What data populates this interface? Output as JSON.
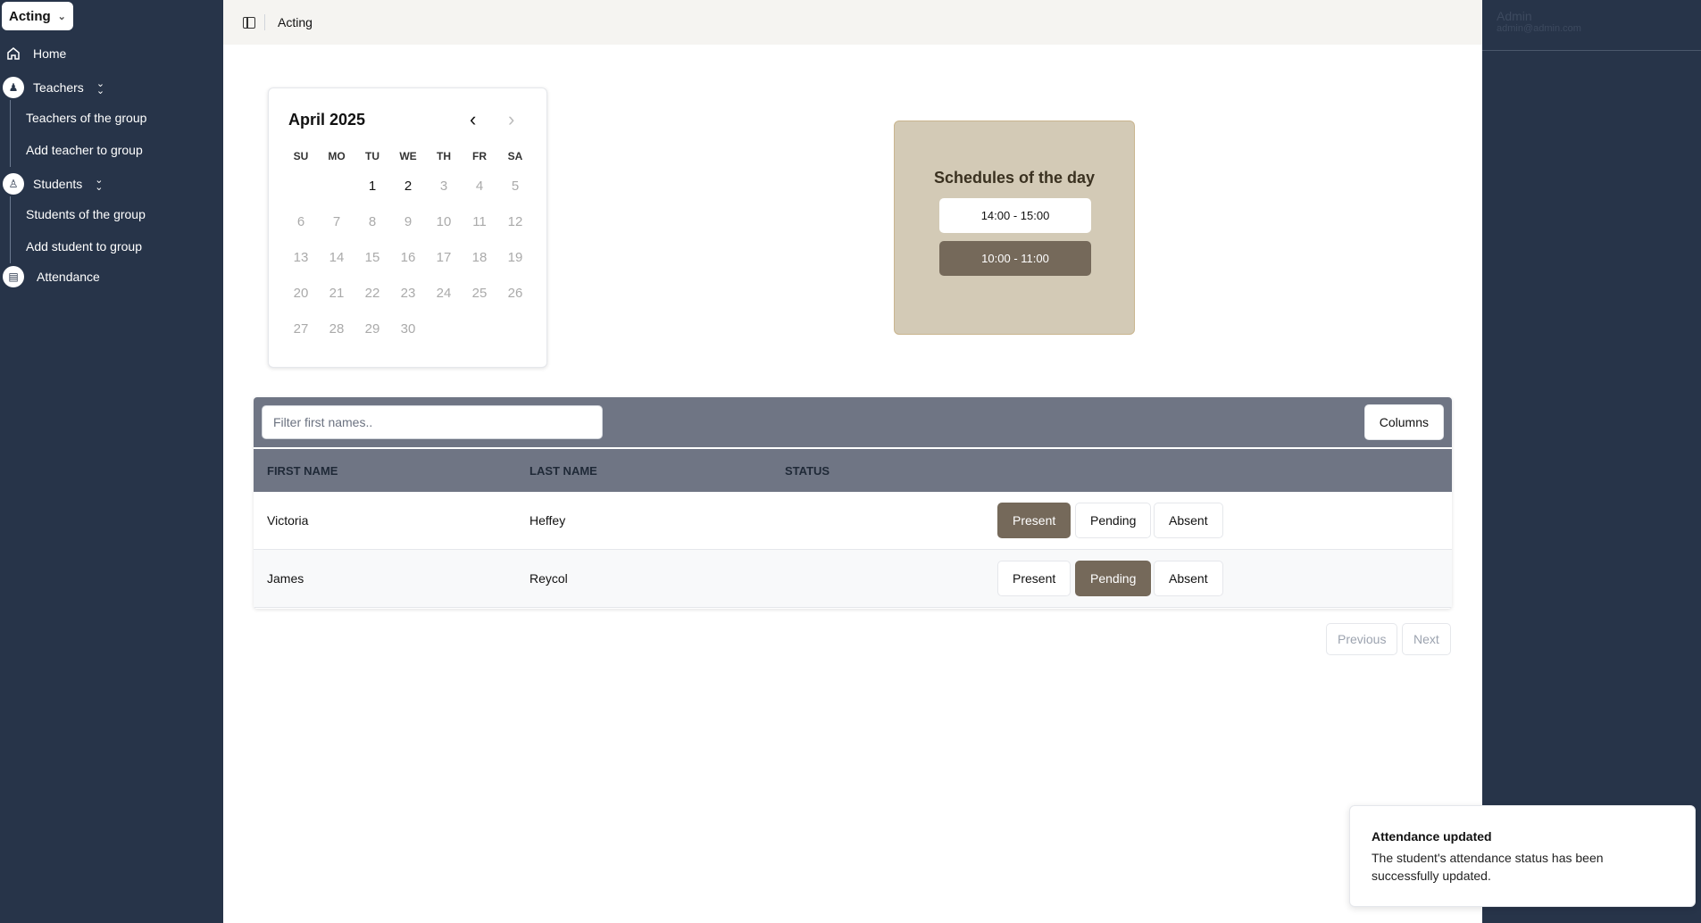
{
  "sidebar": {
    "group_select": "Acting",
    "home": "Home",
    "teachers": "Teachers",
    "teachers_sub": [
      "Teachers of the group",
      "Add teacher to group"
    ],
    "students": "Students",
    "students_sub": [
      "Students of the group",
      "Add student to group"
    ],
    "attendance": "Attendance"
  },
  "topbar": {
    "title": "Acting"
  },
  "user": {
    "name": "Admin",
    "email": "admin@admin.com"
  },
  "calendar": {
    "month": "April 2025",
    "weekdays": [
      "SU",
      "MO",
      "TU",
      "WE",
      "TH",
      "FR",
      "SA"
    ],
    "days": [
      "",
      "",
      "1",
      "2",
      "3",
      "4",
      "5",
      "6",
      "7",
      "8",
      "9",
      "10",
      "11",
      "12",
      "13",
      "14",
      "15",
      "16",
      "17",
      "18",
      "19",
      "20",
      "21",
      "22",
      "23",
      "24",
      "25",
      "26",
      "27",
      "28",
      "29",
      "30"
    ],
    "enabled_days": [
      "1",
      "2"
    ]
  },
  "schedules": {
    "title": "Schedules of the day",
    "slots": [
      "14:00 - 15:00",
      "10:00 - 11:00"
    ]
  },
  "table": {
    "filter_placeholder": "Filter first names..",
    "columns_label": "Columns",
    "headers": [
      "FIRST NAME",
      "LAST NAME",
      "STATUS"
    ],
    "status_options": [
      "Present",
      "Pending",
      "Absent"
    ],
    "rows": [
      {
        "first": "Victoria",
        "last": "Heffey",
        "status": "Present"
      },
      {
        "first": "James",
        "last": "Reycol",
        "status": "Pending"
      }
    ]
  },
  "pager": {
    "previous": "Previous",
    "next": "Next"
  },
  "toast": {
    "title": "Attendance updated",
    "body": "The student's attendance status has been successfully updated."
  },
  "colors": {
    "sidebar_bg": "#273449",
    "accent": "#75695a",
    "schedule_card": "#d3cab6",
    "table_header": "#6f7584"
  }
}
